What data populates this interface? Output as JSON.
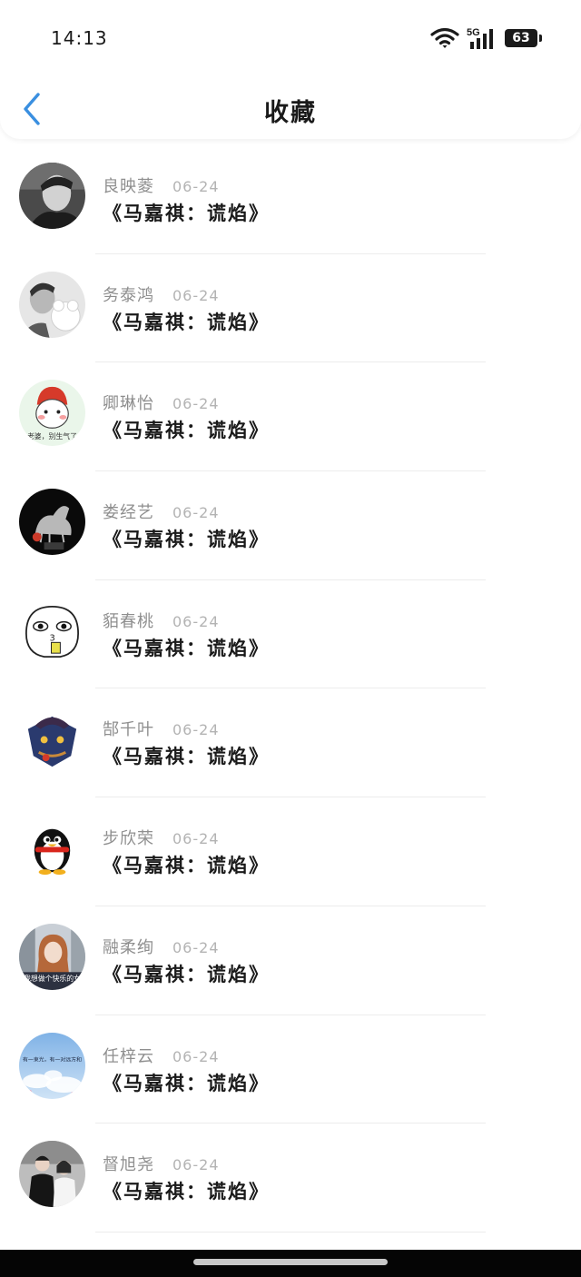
{
  "status_bar": {
    "time": "14:13",
    "network": "5G",
    "battery": "63"
  },
  "header": {
    "back_icon": "chevron-left-icon",
    "title": "收藏",
    "accent_color": "#3a8fe0"
  },
  "favorites": [
    {
      "name": "良映菱",
      "date": "06-24",
      "title": "《马嘉祺：谎焰》",
      "avatar": "photo-man"
    },
    {
      "name": "务泰鸿",
      "date": "06-24",
      "title": "《马嘉祺：谎焰》",
      "avatar": "photo-man-bear"
    },
    {
      "name": "卿琳怡",
      "date": "06-24",
      "title": "《马嘉祺：谎焰》",
      "avatar": "cartoon-red-hair",
      "avatar_caption": "老婆，别生气了"
    },
    {
      "name": "娄经艺",
      "date": "06-24",
      "title": "《马嘉祺：谎焰》",
      "avatar": "glass-horse-statue"
    },
    {
      "name": "貊春桃",
      "date": "06-24",
      "title": "《马嘉祺：谎焰》",
      "avatar": "cartoon-drink"
    },
    {
      "name": "郜千叶",
      "date": "06-24",
      "title": "《马嘉祺：谎焰》",
      "avatar": "game-badge"
    },
    {
      "name": "步欣荣",
      "date": "06-24",
      "title": "《马嘉祺：谎焰》",
      "avatar": "qq-penguin"
    },
    {
      "name": "融柔绚",
      "date": "06-24",
      "title": "《马嘉祺：谎焰》",
      "avatar": "photo-girl",
      "avatar_caption": "我想做个快乐的女"
    },
    {
      "name": "任梓云",
      "date": "06-24",
      "title": "《马嘉祺：谎焰》",
      "avatar": "sky-clouds",
      "avatar_caption": "有一束光，有一对远方和"
    },
    {
      "name": "督旭尧",
      "date": "06-24",
      "title": "《马嘉祺：谎焰》",
      "avatar": "photo-couple"
    }
  ]
}
